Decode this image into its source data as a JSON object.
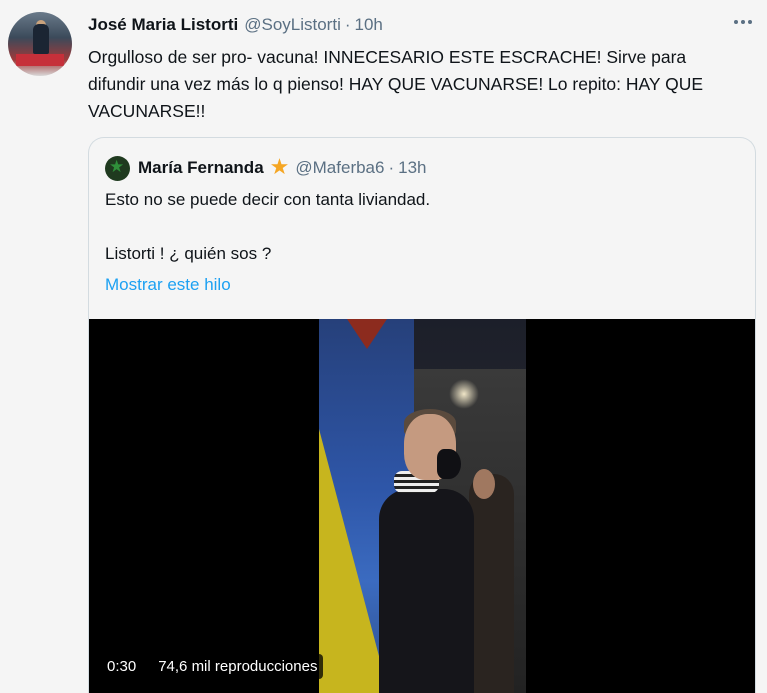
{
  "tweet": {
    "author_name": "José Maria Listorti",
    "author_handle": "@SoyListorti",
    "separator": "·",
    "time": "10h",
    "text": "Orgulloso de ser pro- vacuna! INNECESARIO ESTE ESCRACHE! Sirve para difundir una vez más lo q pienso! HAY QUE VACUNARSE! Lo repito: HAY QUE VACUNARSE!!",
    "more_icon": "more-horizontal-icon"
  },
  "quote": {
    "author_name": "María Fernanda",
    "badge_icon": "star-icon",
    "author_handle": "@Maferba6",
    "separator": "·",
    "time": "13h",
    "text_line1": "Esto no se puede decir con tanta liviandad.",
    "text_line2": "Listorti !  ¿ quién sos ?",
    "show_thread": "Mostrar este hilo",
    "video": {
      "duration": "0:30",
      "views": "74,6 mil reproducciones"
    }
  },
  "colors": {
    "link": "#1da1f2",
    "secondary_text": "#5b7083",
    "star": "#f5a623"
  }
}
